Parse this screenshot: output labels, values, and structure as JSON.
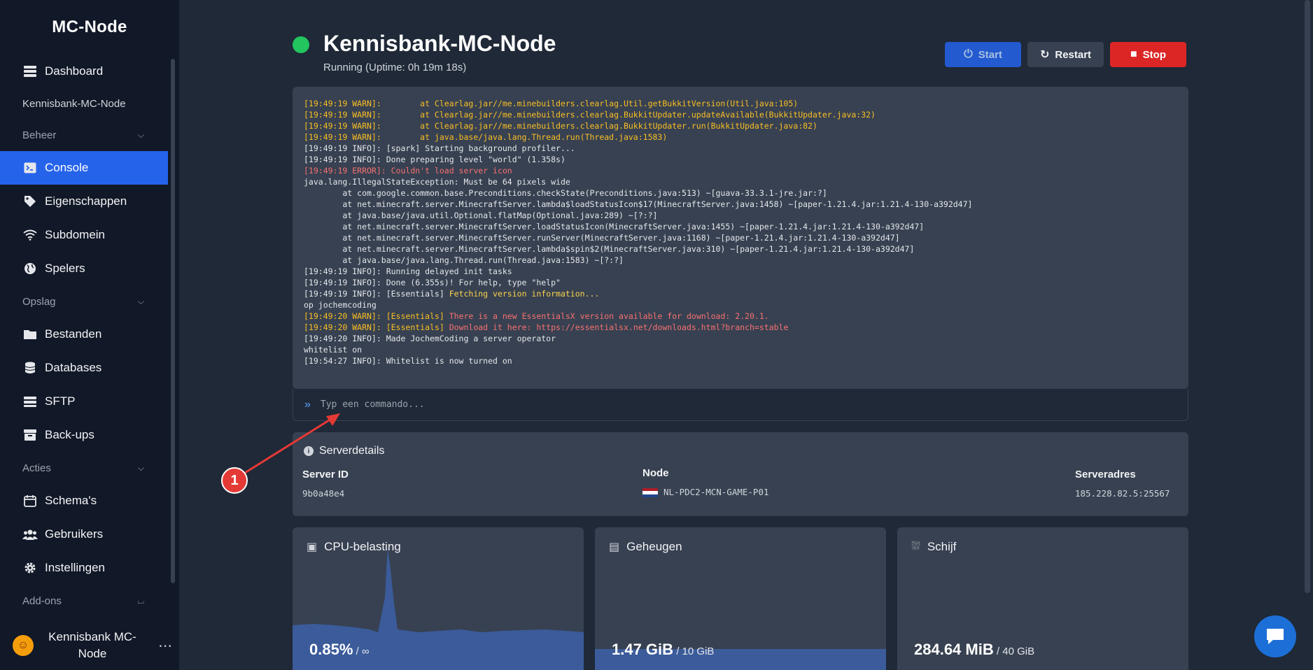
{
  "brand": "MC-Node",
  "sidebar": {
    "dashboard": "Dashboard",
    "server_name": "Kennisbank-MC-Node",
    "section_beheer": "Beheer",
    "beheer_items": [
      "Console",
      "Eigenschappen",
      "Subdomein",
      "Spelers"
    ],
    "section_opslag": "Opslag",
    "opslag_items": [
      "Bestanden",
      "Databases",
      "SFTP",
      "Back-ups"
    ],
    "section_acties": "Acties",
    "acties_items": [
      "Schema's",
      "Gebruikers",
      "Instellingen"
    ],
    "section_addons": "Add-ons",
    "user_line1": "Kennisbank MC-",
    "user_line2": "Node",
    "user_more": "⋯"
  },
  "server": {
    "title": "Kennisbank-MC-Node",
    "status": "Running (Uptime: 0h 19m 18s)",
    "status_color": "#22c55e"
  },
  "buttons": {
    "start": "Start",
    "restart": "Restart",
    "stop": "Stop"
  },
  "console": {
    "lines": [
      {
        "cls": "warn",
        "text": "[19:49:19 WARN]:        at Clearlag.jar//me.minebuilders.clearlag.Util.getBukkitVersion(Util.java:105)"
      },
      {
        "cls": "warn",
        "text": "[19:49:19 WARN]:        at Clearlag.jar//me.minebuilders.clearlag.BukkitUpdater.updateAvailable(BukkitUpdater.java:32)"
      },
      {
        "cls": "warn",
        "text": "[19:49:19 WARN]:        at Clearlag.jar//me.minebuilders.clearlag.BukkitUpdater.run(BukkitUpdater.java:82)"
      },
      {
        "cls": "warn",
        "text": "[19:49:19 WARN]:        at java.base/java.lang.Thread.run(Thread.java:1583)"
      },
      {
        "cls": "",
        "text": "[19:49:19 INFO]: [spark] Starting background profiler..."
      },
      {
        "cls": "",
        "text": "[19:49:19 INFO]: Done preparing level \"world\" (1.358s)"
      },
      {
        "cls": "err",
        "text": "[19:49:19 ERROR]: Couldn't load server icon"
      },
      {
        "cls": "",
        "text": "java.lang.IllegalStateException: Must be 64 pixels wide"
      },
      {
        "cls": "",
        "text": "        at com.google.common.base.Preconditions.checkState(Preconditions.java:513) ~[guava-33.3.1-jre.jar:?]"
      },
      {
        "cls": "",
        "text": "        at net.minecraft.server.MinecraftServer.lambda$loadStatusIcon$17(MinecraftServer.java:1458) ~[paper-1.21.4.jar:1.21.4-130-a392d47]"
      },
      {
        "cls": "",
        "text": "        at java.base/java.util.Optional.flatMap(Optional.java:289) ~[?:?]"
      },
      {
        "cls": "",
        "text": "        at net.minecraft.server.MinecraftServer.loadStatusIcon(MinecraftServer.java:1455) ~[paper-1.21.4.jar:1.21.4-130-a392d47]"
      },
      {
        "cls": "",
        "text": "        at net.minecraft.server.MinecraftServer.runServer(MinecraftServer.java:1168) ~[paper-1.21.4.jar:1.21.4-130-a392d47]"
      },
      {
        "cls": "",
        "text": "        at net.minecraft.server.MinecraftServer.lambda$spin$2(MinecraftServer.java:310) ~[paper-1.21.4.jar:1.21.4-130-a392d47]"
      },
      {
        "cls": "",
        "text": "        at java.base/java.lang.Thread.run(Thread.java:1583) ~[?:?]"
      },
      {
        "cls": "",
        "text": "[19:49:19 INFO]: Running delayed init tasks"
      },
      {
        "cls": "",
        "text": "[19:49:19 INFO]: Done (6.355s)! For help, type \"help\""
      },
      {
        "cls": "mixed",
        "prefix": "[19:49:19 INFO]: [Essentials] ",
        "text": "Fetching version information..."
      },
      {
        "cls": "",
        "text": "op jochemcoding"
      },
      {
        "cls": "mixed-warn",
        "prefix": "[19:49:20 WARN]: [Essentials] ",
        "text": "There is a new EssentialsX version available for download: 2.20.1."
      },
      {
        "cls": "mixed-warn",
        "prefix": "[19:49:20 WARN]: [Essentials] ",
        "text": "Download it here: https://essentialsx.net/downloads.html?branch=stable"
      },
      {
        "cls": "",
        "text": "[19:49:20 INFO]: Made JochemCoding a server operator"
      },
      {
        "cls": "",
        "text": "whitelist on"
      },
      {
        "cls": "",
        "text": "[19:54:27 INFO]: Whitelist is now turned on"
      }
    ],
    "prompt_icon": "chevron-double-right-icon",
    "placeholder": "Typ een commando..."
  },
  "details": {
    "title": "Serverdetails",
    "server_id_label": "Server ID",
    "server_id": "9b0a48e4",
    "node_label": "Node",
    "node": "NL-PDC2-MCN-GAME-P01",
    "address_label": "Serveradres",
    "address": "185.228.82.5:25567"
  },
  "stats": {
    "cpu_title": "CPU-belasting",
    "cpu_value": "0.85%",
    "cpu_max": " / ∞",
    "mem_title": "Geheugen",
    "mem_value": "1.47 GiB",
    "mem_max": " / 10 GiB",
    "mem_fraction": 0.147,
    "disk_title": "Schijf",
    "disk_value": "284.64 MiB",
    "disk_max": " / 40 GiB"
  },
  "annotation": "1",
  "colors": {
    "accent": "#2563eb",
    "stop": "#dc2626",
    "warn": "#fbbf24",
    "error": "#f87171",
    "annotation": "#e53935"
  }
}
